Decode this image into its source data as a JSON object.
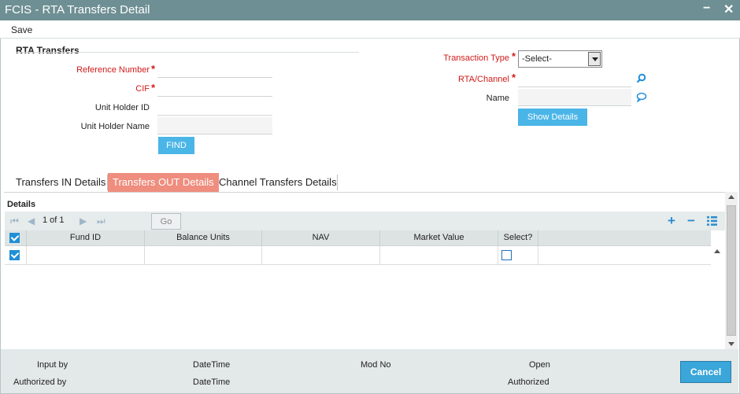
{
  "window": {
    "title": "FCIS - RTA Transfers Detail",
    "minimize": "−",
    "close": "✕"
  },
  "menu": {
    "save": "Save"
  },
  "section": {
    "title": "RTA Transfers"
  },
  "form": {
    "reference_number_label": "Reference Number",
    "cif_label": "CIF",
    "unit_holder_id_label": "Unit Holder ID",
    "unit_holder_name_label": "Unit Holder Name",
    "find": "FIND",
    "transaction_type_label": "Transaction Type",
    "transaction_type_value": "-Select-",
    "rta_channel_label": "RTA/Channel",
    "name_label": "Name",
    "show_details": "Show Details",
    "required_mark": "*"
  },
  "tabs": [
    "Transfers IN Details",
    "Transfers OUT Details",
    "Channel Transfers Details"
  ],
  "active_tab": 1,
  "details": {
    "title": "Details",
    "page_info": "1 of 1",
    "go": "Go",
    "columns": [
      "Fund ID",
      "Balance Units",
      "NAV",
      "Market Value",
      "Select?"
    ]
  },
  "footer": {
    "input_by": "Input by",
    "datetime": "DateTime",
    "mod_no": "Mod No",
    "open": "Open",
    "authorized_by": "Authorized by",
    "authorized": "Authorized",
    "cancel": "Cancel"
  },
  "colors": {
    "titlebar": "#6e8f93",
    "active_tab": "#ef8d7e",
    "button": "#4ab5e7",
    "required": "#d21a1a"
  }
}
